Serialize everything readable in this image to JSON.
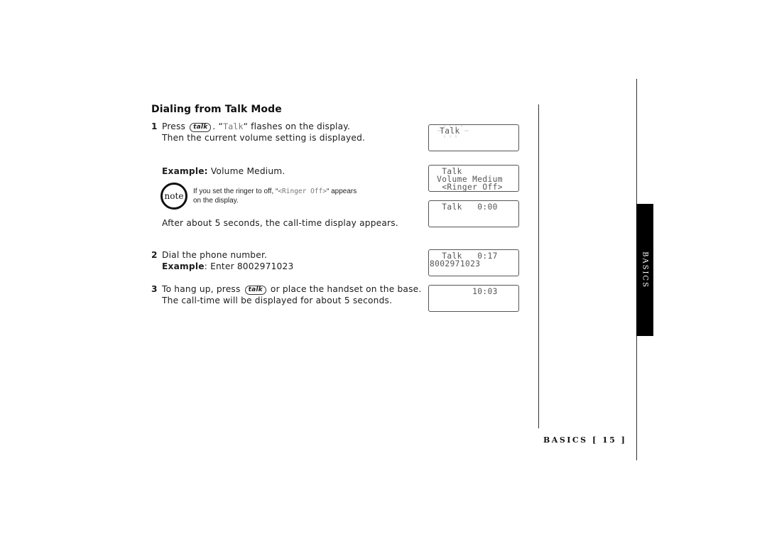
{
  "section": {
    "title": "Dialing from Talk Mode"
  },
  "steps": [
    {
      "number": "1",
      "line1_prefix": "Press",
      "key_label": "talk",
      "line1_mid": ". “",
      "lcd_word": "Talk",
      "line1_suffix": "“ flashes on the display.",
      "line2": "Then the current volume setting is displayed."
    },
    {
      "number": "2",
      "line1": "Dial the phone number.",
      "example_label": "Example",
      "example_text": ": Enter 8002971023"
    },
    {
      "number": "3",
      "line1_prefix": "To hang up, press",
      "key_label": "talk",
      "line1_suffix": "or place the handset on the base.",
      "line2": "The call-time will be displayed for about 5 seconds."
    }
  ],
  "example": {
    "label": "Example:",
    "text": "Volume Medium."
  },
  "note": {
    "icon_label": "note",
    "prefix": "If you set the ringer to off, “",
    "lcd": "<Ringer Off>",
    "suffix": "“ appears",
    "line2": "on the display."
  },
  "after_text": "After about 5 seconds, the call-time display appears.",
  "lcd_displays": [
    {
      "lines": [
        " Talk"
      ],
      "flashing": true
    },
    {
      "lines": [
        "  Talk",
        " Volume Medium",
        "  <Ringer Off>"
      ]
    },
    {
      "lines": [
        "  Talk   0:00"
      ]
    },
    {
      "lines": [
        "  Talk   0:17",
        "8002971023"
      ]
    },
    {
      "lines": [
        "        10:03"
      ]
    }
  ],
  "side_tab": {
    "label": "BASICS"
  },
  "footer": {
    "section": "BASICS",
    "page": "[ 15 ]"
  }
}
